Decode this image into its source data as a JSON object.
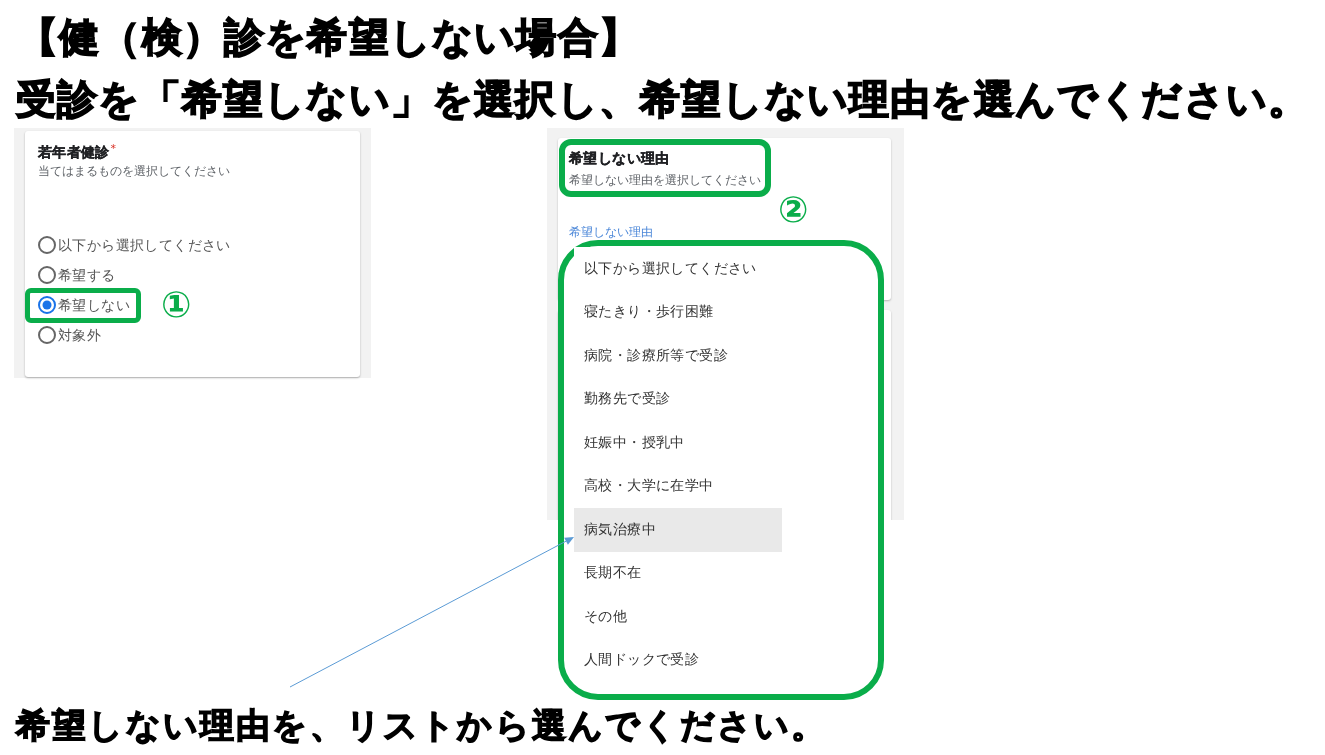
{
  "heading": "【健（検）診を希望しない場合】",
  "instruction": "受診を「希望しない」を選択し、希望しない理由を選んでください。",
  "step_1": {
    "marker": "①",
    "card": {
      "title": "若年者健診",
      "required_mark": "*",
      "hint": "当てはまるものを選択してください",
      "options": [
        {
          "label": "以下から選択してください",
          "selected": false
        },
        {
          "label": "希望する",
          "selected": false
        },
        {
          "label": "希望しない",
          "selected": true
        },
        {
          "label": "対象外",
          "selected": false
        }
      ]
    }
  },
  "step_2": {
    "marker": "②",
    "card": {
      "title": "希望しない理由",
      "hint": "希望しない理由を選択してください",
      "field_label": "希望しない理由"
    },
    "dropdown": {
      "options": [
        {
          "label": "以下から選択してください",
          "selected": false
        },
        {
          "label": "寝たきり・歩行困難",
          "selected": false
        },
        {
          "label": "病院・診療所等で受診",
          "selected": false
        },
        {
          "label": "勤務先で受診",
          "selected": false
        },
        {
          "label": "妊娠中・授乳中",
          "selected": false
        },
        {
          "label": "高校・大学に在学中",
          "selected": false
        },
        {
          "label": "病気治療中",
          "selected": true
        },
        {
          "label": "長期不在",
          "selected": false
        },
        {
          "label": "その他",
          "selected": false
        },
        {
          "label": "人間ドックで受診",
          "selected": false
        }
      ]
    }
  },
  "caption": "希望しない理由を、リストから選んでください。"
}
